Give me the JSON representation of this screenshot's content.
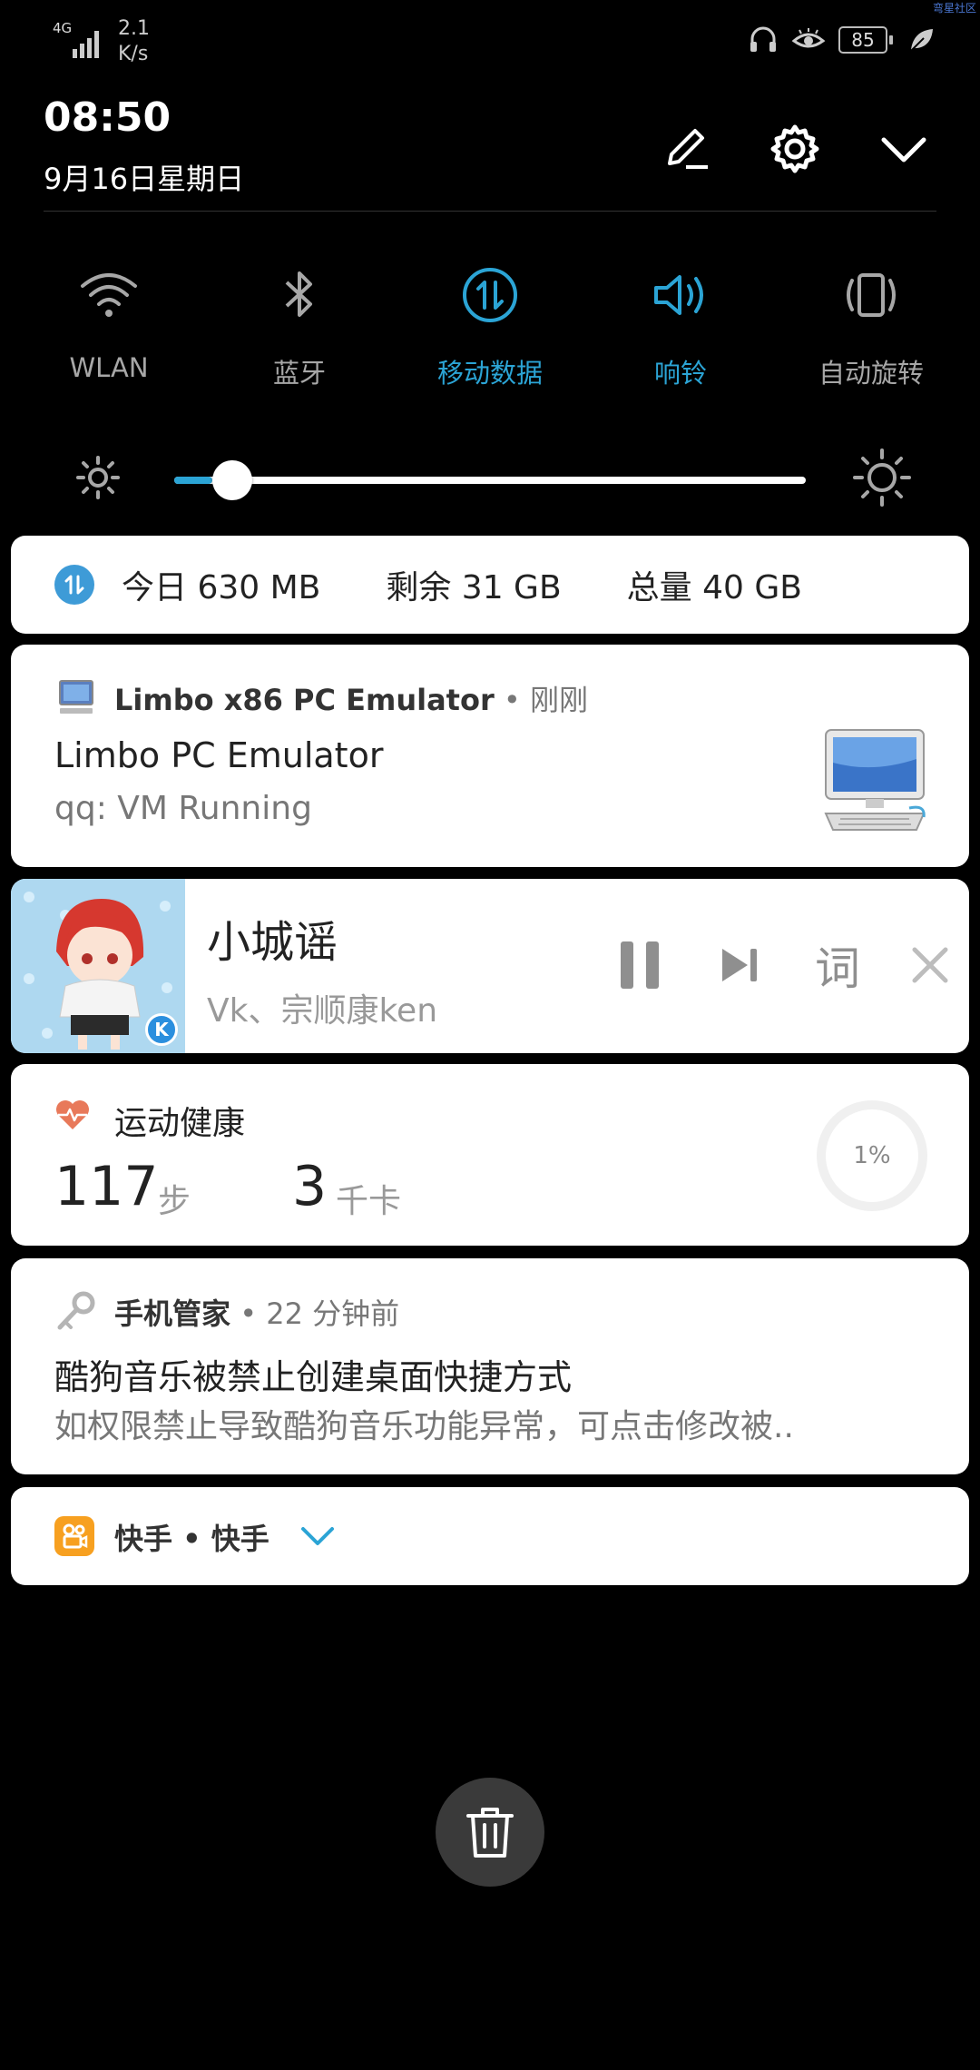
{
  "status_bar": {
    "network_type": "4G",
    "net_speed_value": "2.1",
    "net_speed_unit": "K/s",
    "battery": "85",
    "corner_text": "弯星社区",
    "icons": [
      "signal-icon",
      "headset-icon",
      "eye-icon",
      "battery-icon",
      "leaf-icon"
    ]
  },
  "header": {
    "time": "08:50",
    "date": "9月16日星期日",
    "buttons": [
      "edit-icon",
      "settings-icon",
      "collapse-icon"
    ]
  },
  "toggles": [
    {
      "label": "WLAN",
      "active": false,
      "icon": "wifi-icon"
    },
    {
      "label": "蓝牙",
      "active": false,
      "icon": "bluetooth-icon"
    },
    {
      "label": "移动数据",
      "active": true,
      "icon": "mobile-data-icon"
    },
    {
      "label": "响铃",
      "active": true,
      "icon": "ring-icon"
    },
    {
      "label": "自动旋转",
      "active": false,
      "icon": "auto-rotate-icon"
    }
  ],
  "brightness": {
    "level_fraction": 0.06
  },
  "data_usage": {
    "today": "今日 630 MB",
    "remaining": "剩余 31 GB",
    "total": "总量 40 GB"
  },
  "limbo_notification": {
    "app_name": "Limbo x86 PC Emulator",
    "when": " • 刚刚",
    "title": "Limbo PC Emulator",
    "text": "qq: VM Running"
  },
  "music": {
    "song": "小城谣",
    "artist": "Vk、宗顺康ken",
    "lyrics_button": "词",
    "badge": "K"
  },
  "health": {
    "app_name": "运动健康",
    "steps": "117",
    "steps_unit": "步",
    "calories": "3",
    "calories_unit": "千卡",
    "goal_percent": "1%"
  },
  "manager_notification": {
    "app_name": "手机管家",
    "when": " • 22 分钟前",
    "title": "酷狗音乐被禁止创建桌面快捷方式",
    "text": "如权限禁止导致酷狗音乐功能异常，可点击修改被.."
  },
  "kuaishou": {
    "line": "快手 • 快手"
  },
  "colors": {
    "accent": "#2ba4d5",
    "inactive": "#a7a7a7",
    "background": "#000000",
    "card": "#ffffff",
    "health_heart": "#e8795a",
    "kuaishou": "#f7a020"
  }
}
